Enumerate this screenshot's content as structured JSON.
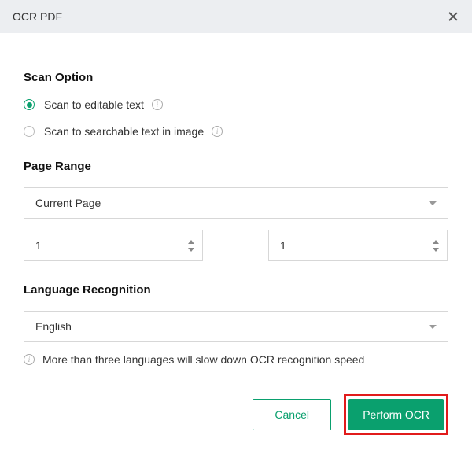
{
  "titlebar": {
    "title": "OCR PDF"
  },
  "scanOption": {
    "heading": "Scan Option",
    "options": [
      {
        "label": "Scan to editable text",
        "selected": true
      },
      {
        "label": "Scan to searchable text in image",
        "selected": false
      }
    ]
  },
  "pageRange": {
    "heading": "Page Range",
    "selected": "Current Page",
    "from": "1",
    "to": "1"
  },
  "language": {
    "heading": "Language Recognition",
    "selected": "English",
    "hint": "More than three languages will slow down OCR recognition speed"
  },
  "buttons": {
    "cancel": "Cancel",
    "perform": "Perform OCR"
  }
}
